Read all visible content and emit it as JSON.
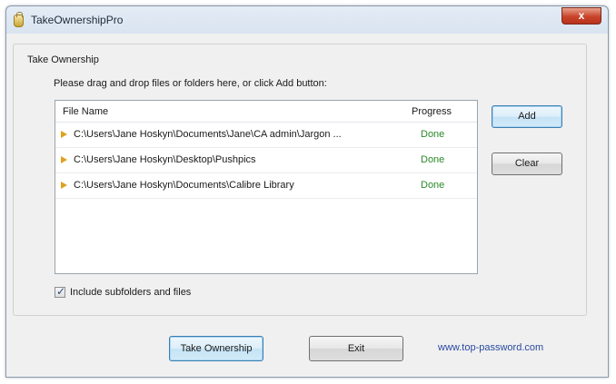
{
  "window": {
    "title": "TakeOwnershipPro",
    "close_label": "x"
  },
  "group": {
    "title": "Take Ownership",
    "instructions": "Please drag and drop files or folders here, or click Add button:"
  },
  "list": {
    "columns": {
      "name": "File Name",
      "progress": "Progress"
    },
    "rows": [
      {
        "path": "C:\\Users\\Jane Hoskyn\\Documents\\Jane\\CA admin\\Jargon ...",
        "status": "Done"
      },
      {
        "path": "C:\\Users\\Jane Hoskyn\\Desktop\\Pushpics",
        "status": "Done"
      },
      {
        "path": "C:\\Users\\Jane Hoskyn\\Documents\\Calibre Library",
        "status": "Done"
      }
    ]
  },
  "buttons": {
    "add": "Add",
    "clear": "Clear",
    "take_ownership": "Take Ownership",
    "exit": "Exit"
  },
  "checkbox": {
    "label": "Include subfolders and files",
    "checked": true,
    "mark": "✓"
  },
  "footer": {
    "link": "www.top-password.com"
  },
  "colors": {
    "status_done": "#2a8a2a",
    "link": "#2a4aa0",
    "close_button": "#c8442a"
  }
}
